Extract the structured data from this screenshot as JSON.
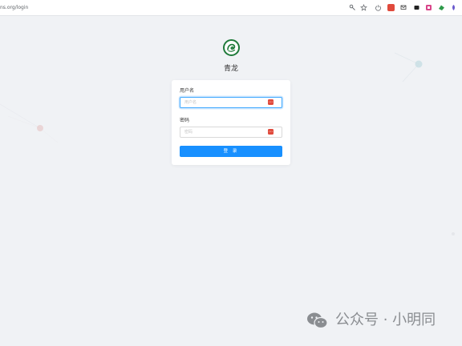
{
  "browser": {
    "url": "ns.org/login",
    "colors": {
      "ext_red": "#e04a3c",
      "ext_green": "#2e9a4a",
      "ext_blue": "#6a5acd"
    }
  },
  "app": {
    "title": "青龙",
    "logo_icon": "qinglong-dragon-logo"
  },
  "login": {
    "username_label": "用户名",
    "username_placeholder": "用户名",
    "password_label": "密码",
    "password_placeholder": "密码",
    "submit_label": "登 录",
    "accent_color": "#1890ff"
  },
  "watermark": {
    "text": "公众号 · 小明同"
  }
}
